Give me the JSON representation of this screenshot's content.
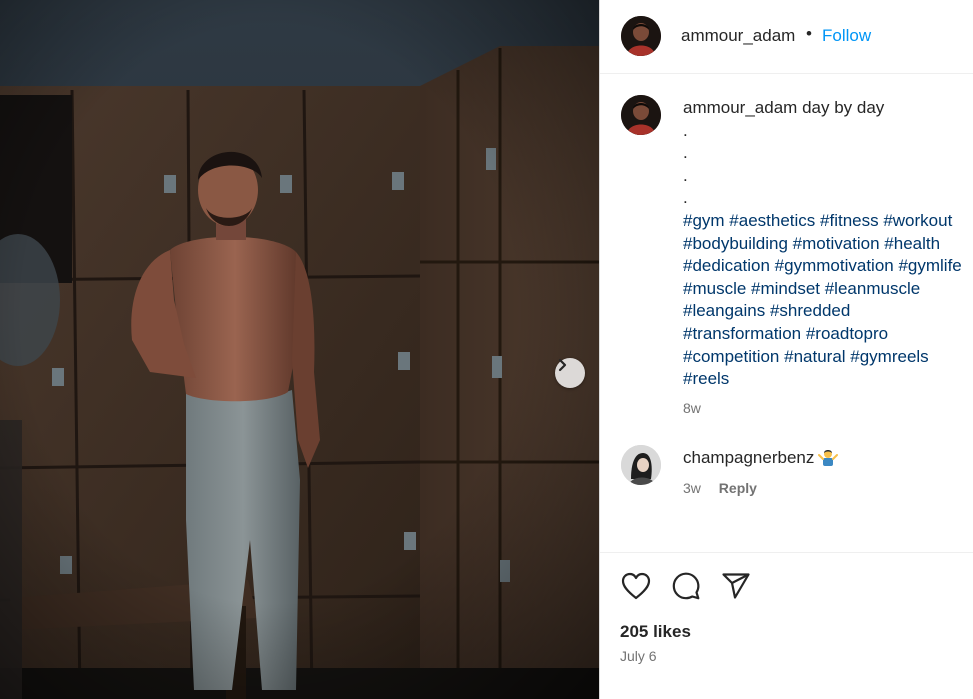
{
  "post": {
    "username": "ammour_adam",
    "separator": "•",
    "follow_label": "Follow",
    "caption_text": "day by day",
    "caption_dots": [
      ".",
      ".",
      ".",
      "."
    ],
    "hashtag_lines": [
      "#gym #aesthetics #fitness #workout",
      "#bodybuilding #motivation #health",
      "#dedication #gymmotivation #gymlife",
      "#muscle #mindset #leanmuscle",
      "#leangains #shredded",
      "#transformation #roadtopro",
      "#competition #natural #gymreels",
      "#reels"
    ],
    "caption_age": "8w",
    "likes": "205 likes",
    "date": "July 6"
  },
  "comment": {
    "username": "champagnerbenz",
    "age": "3w",
    "reply_label": "Reply"
  },
  "icons": {
    "like": "heart-icon",
    "comment": "speech-bubble-icon",
    "share": "paper-plane-icon",
    "next": "chevron-right-icon",
    "emoji": "person-shrugging-emoji"
  },
  "colors": {
    "link": "#0095f6",
    "hashtag": "#00376b",
    "secondary_text": "#737373"
  }
}
